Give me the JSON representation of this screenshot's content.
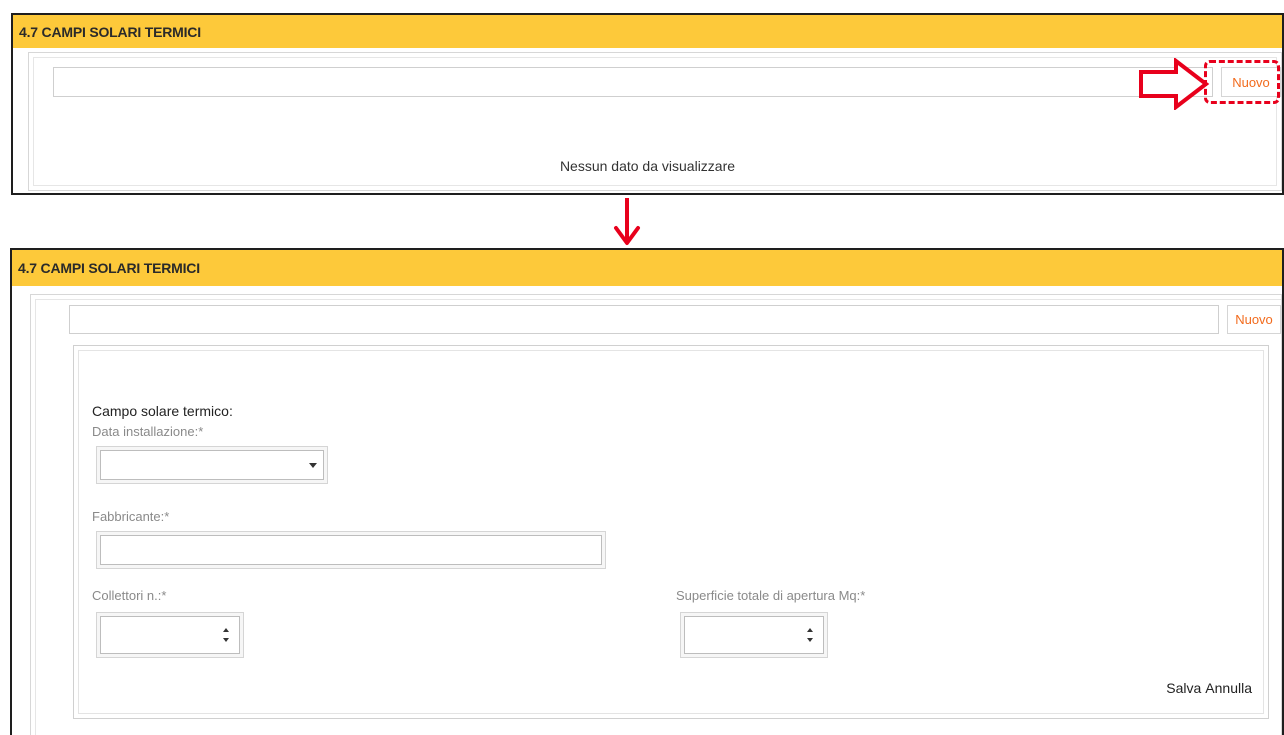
{
  "panel_top": {
    "section_title": "4.7 CAMPI SOLARI TERMICI",
    "new_button_label": "Nuovo",
    "empty_message": "Nessun dato da visualizzare"
  },
  "panel_bottom": {
    "section_title": "4.7 CAMPI SOLARI TERMICI",
    "new_button_label": "Nuovo",
    "form": {
      "title": "Campo solare termico:",
      "data_installazione": {
        "label": "Data installazione:*",
        "value": ""
      },
      "fabbricante": {
        "label": "Fabbricante:*",
        "value": ""
      },
      "collettori": {
        "label": "Collettori n.:*",
        "value": ""
      },
      "superficie": {
        "label": "Superficie totale di apertura Mq:*",
        "value": ""
      },
      "save_label": "Salva",
      "cancel_label": "Annulla"
    }
  },
  "annotations": {
    "highlight_color": "#e8001c",
    "header_color": "#fdc93a",
    "button_text_color": "#f26b1d"
  }
}
